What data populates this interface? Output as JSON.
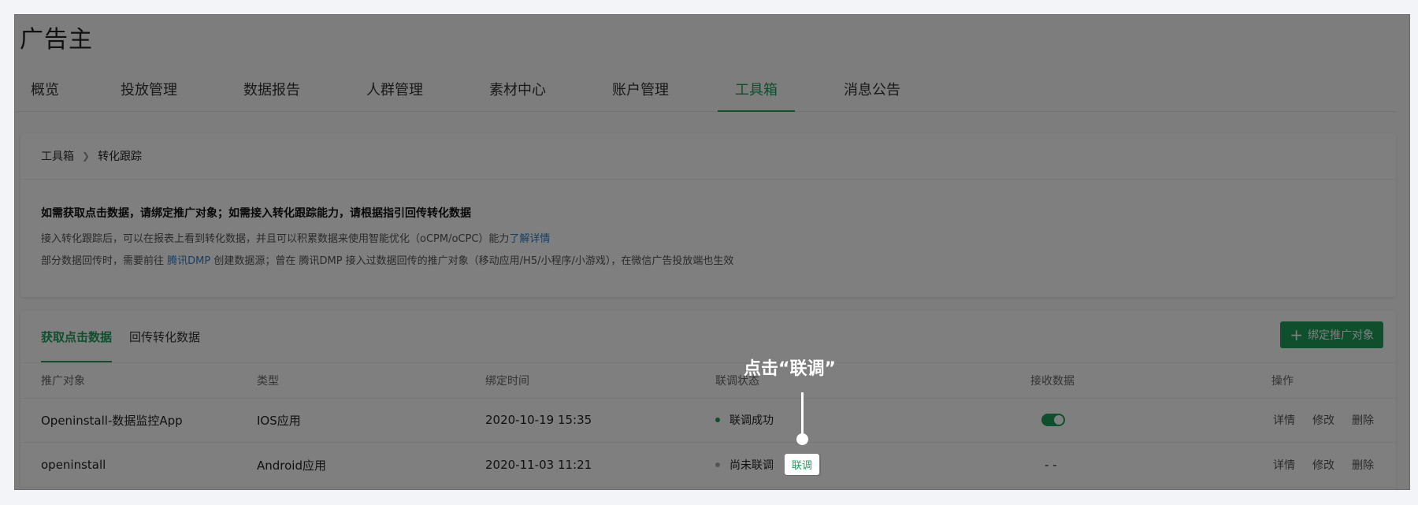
{
  "app": {
    "title": "广告主"
  },
  "nav": {
    "items": [
      {
        "label": "概览"
      },
      {
        "label": "投放管理"
      },
      {
        "label": "数据报告"
      },
      {
        "label": "人群管理"
      },
      {
        "label": "素材中心"
      },
      {
        "label": "账户管理"
      },
      {
        "label": "工具箱"
      },
      {
        "label": "消息公告"
      }
    ],
    "active": "工具箱"
  },
  "breadcrumb": {
    "parent": "工具箱",
    "current": "转化跟踪"
  },
  "notice": {
    "title": "如需获取点击数据，请绑定推广对象；如需接入转化跟踪能力，请根据指引回传转化数据",
    "line1_prefix": "接入转化跟踪后，可以在报表上看到转化数据，并且可以积累数据来使用智能优化（oCPM/oCPC）能力",
    "line1_link": "了解详情",
    "line2_prefix": "部分数据回传时，需要前往 ",
    "line2_link": "腾讯DMP",
    "line2_suffix": " 创建数据源；曾在 腾讯DMP 接入过数据回传的推广对象（移动应用/H5/小程序/小游戏），在微信广告投放端也生效"
  },
  "tabs": [
    {
      "label": "获取点击数据",
      "active": true
    },
    {
      "label": "回传转化数据",
      "active": false
    }
  ],
  "bind_button": {
    "label": "绑定推广对象"
  },
  "table": {
    "headers": [
      "推广对象",
      "类型",
      "绑定时间",
      "联调状态",
      "接收数据",
      "操作"
    ],
    "rows": [
      {
        "name": "Openinstall-数据监控App",
        "type": "IOS应用",
        "time": "2020-10-19 15:35",
        "status": "联调成功",
        "status_color": "#1e9e5d",
        "receive": "toggle-on",
        "actions": [
          "详情",
          "修改",
          "删除"
        ]
      },
      {
        "name": "openinstall",
        "type": "Android应用",
        "time": "2020-11-03 11:21",
        "status": "尚未联调",
        "status_color": "#aaaaaa",
        "debug_label": "联调",
        "receive_text": "- -",
        "actions": [
          "详情",
          "修改",
          "删除"
        ]
      }
    ]
  },
  "callout": {
    "text": "点击“联调”",
    "button_label": "联调"
  },
  "colors": {
    "accent": "#1e9e5d",
    "link": "#2a7fc9"
  }
}
